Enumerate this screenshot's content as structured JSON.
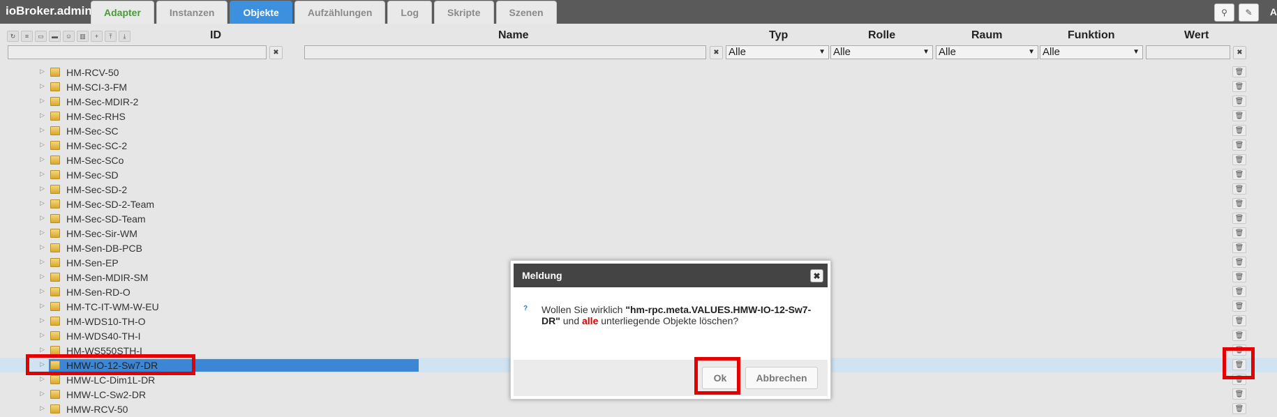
{
  "app": {
    "title": "ioBroker.admin"
  },
  "tabs": [
    {
      "label": "Adapter"
    },
    {
      "label": "Instanzen"
    },
    {
      "label": "Objekte"
    },
    {
      "label": "Aufzählungen"
    },
    {
      "label": "Log"
    },
    {
      "label": "Skripte"
    },
    {
      "label": "Szenen"
    }
  ],
  "top_right": {
    "cut_text": "A"
  },
  "columns": {
    "id": "ID",
    "name": "Name",
    "typ": "Typ",
    "rolle": "Rolle",
    "raum": "Raum",
    "funktion": "Funktion",
    "wert": "Wert"
  },
  "filters": {
    "typ": "Alle",
    "rolle": "Alle",
    "raum": "Alle",
    "funktion": "Alle",
    "clear_symbol": "✖"
  },
  "rows": [
    "HM-RCV-50",
    "HM-SCI-3-FM",
    "HM-Sec-MDIR-2",
    "HM-Sec-RHS",
    "HM-Sec-SC",
    "HM-Sec-SC-2",
    "HM-Sec-SCo",
    "HM-Sec-SD",
    "HM-Sec-SD-2",
    "HM-Sec-SD-2-Team",
    "HM-Sec-SD-Team",
    "HM-Sec-Sir-WM",
    "HM-Sen-DB-PCB",
    "HM-Sen-EP",
    "HM-Sen-MDIR-SM",
    "HM-Sen-RD-O",
    "HM-TC-IT-WM-W-EU",
    "HM-WDS10-TH-O",
    "HM-WDS40-TH-I",
    "HM-WS550STH-I",
    "HMW-IO-12-Sw7-DR",
    "HMW-LC-Dim1L-DR",
    "HMW-LC-Sw2-DR",
    "HMW-RCV-50"
  ],
  "selected_index": 20,
  "dialog": {
    "title": "Meldung",
    "question_mark": "?",
    "msg_pre": "Wollen Sie wirklich ",
    "msg_obj": "\"hm-rpc.meta.VALUES.HMW-IO-12-Sw7-DR\"",
    "msg_mid": " und ",
    "msg_all": "alle",
    "msg_post": " unterliegende Objekte löschen?",
    "ok_label": "Ok",
    "cancel_label": "Abbrechen"
  },
  "colors": {
    "accent": "#3c90dd",
    "highlight": "#e40000",
    "adapter_tab": "#4a9a3a"
  }
}
